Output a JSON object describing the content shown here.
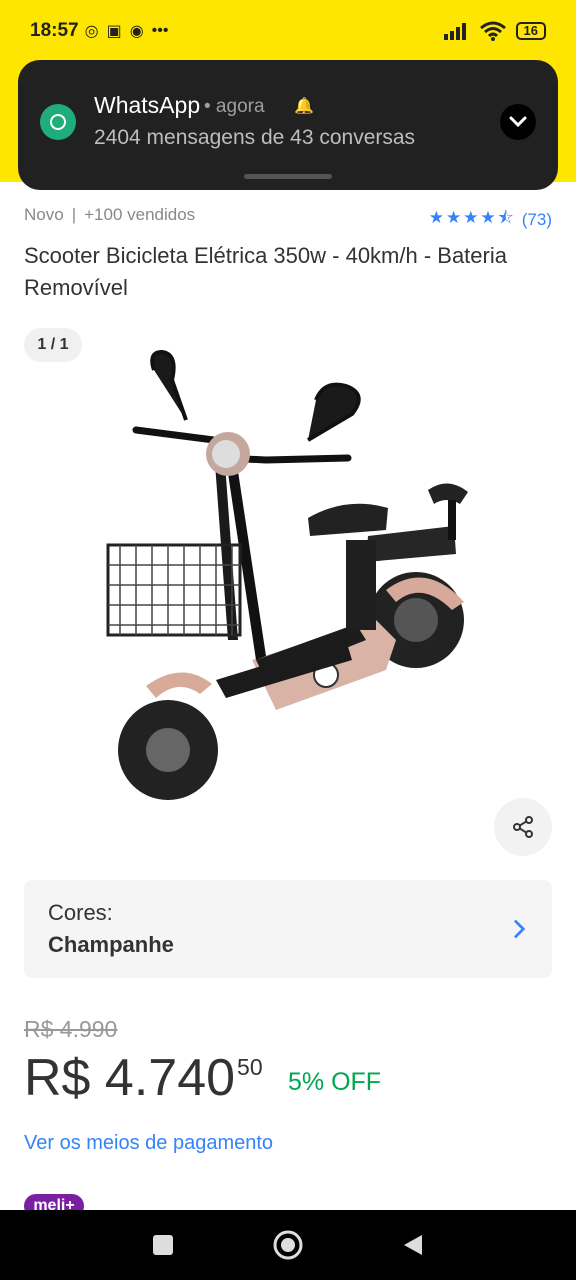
{
  "status_bar": {
    "time": "18:57",
    "battery": "16",
    "icons": [
      "whatsapp-icon",
      "instagram-icon",
      "eye-icon",
      "more-dots-icon",
      "signal-icon",
      "wifi-icon",
      "battery-icon"
    ]
  },
  "notification": {
    "app": "WhatsApp",
    "time": "• agora",
    "text": "2404 mensagens de 43 conversas"
  },
  "product": {
    "condition": "Novo",
    "sold": "+100 vendidos",
    "rating_stars": 4.5,
    "reviews": "(73)",
    "title": "Scooter Bicicleta Elétrica 350w - 40km/h - Bateria Removível",
    "image_counter": "1 / 1"
  },
  "variant": {
    "label": "Cores:",
    "value": "Champanhe"
  },
  "pricing": {
    "original": "R$ 4.990",
    "current_main": "R$ 4.740",
    "current_cents": "50",
    "discount": "5% OFF",
    "payment_link": "Ver os meios de pagamento"
  },
  "badge": {
    "label": "meli+"
  },
  "colors": {
    "header_yellow": "#ffe600",
    "link_blue": "#3483fa",
    "discount_green": "#00a650",
    "meli_purple": "#7a1fa2"
  }
}
